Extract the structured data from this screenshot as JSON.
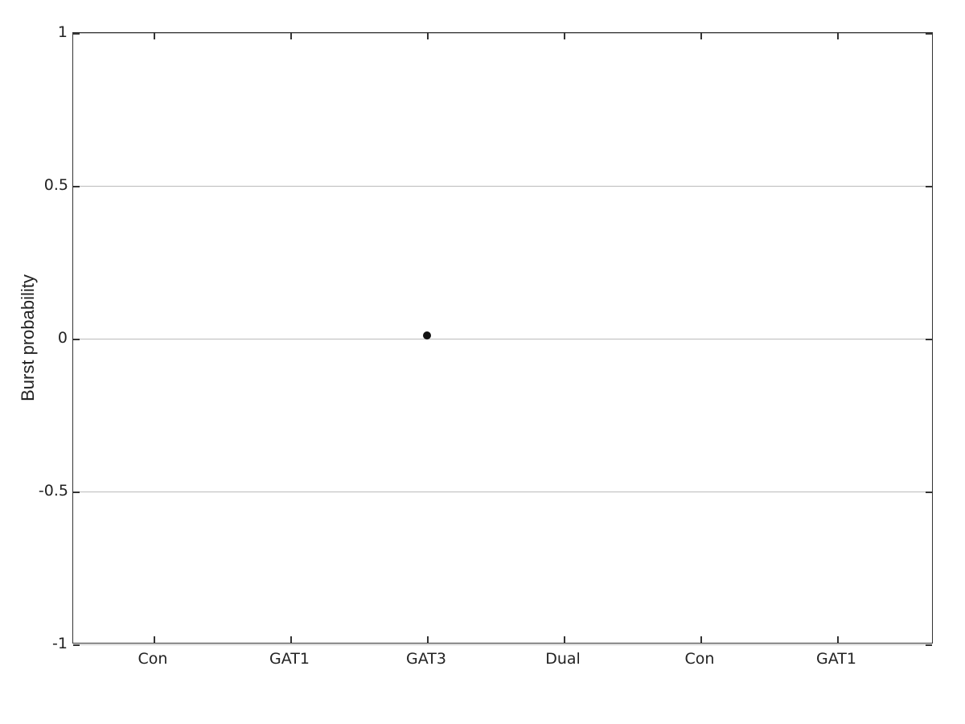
{
  "chart": {
    "title": "",
    "y_axis_label": "Burst probability",
    "x_axis_label": "",
    "background_color": "#ffffff",
    "border_color": "#333333",
    "y_ticks": [
      {
        "value": 1,
        "label": "1"
      },
      {
        "value": 0.5,
        "label": "0.5"
      },
      {
        "value": 0,
        "label": "0"
      },
      {
        "value": -0.5,
        "label": "-0.5"
      },
      {
        "value": -1,
        "label": "-1"
      }
    ],
    "x_ticks": [
      {
        "label": "Con",
        "position": 0
      },
      {
        "label": "GAT1",
        "position": 1
      },
      {
        "label": "GAT3",
        "position": 2
      },
      {
        "label": "Dual",
        "position": 3
      },
      {
        "label": "Con",
        "position": 4
      },
      {
        "label": "GAT1",
        "position": 5
      }
    ],
    "data_points": [
      {
        "x_index": 2,
        "y_value": 0.01
      }
    ]
  }
}
